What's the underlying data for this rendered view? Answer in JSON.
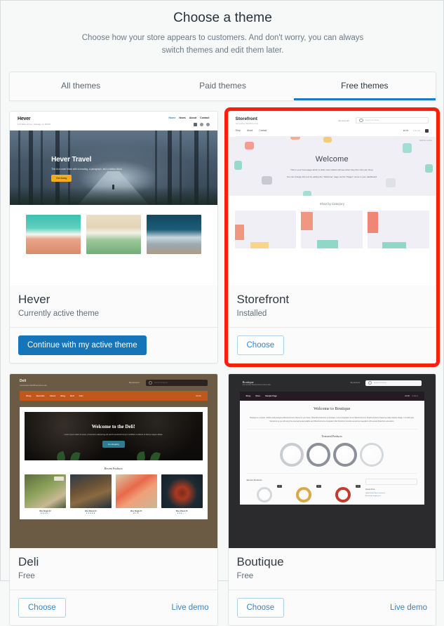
{
  "header": {
    "title": "Choose a theme",
    "subtitle": "Choose how your store appears to customers. And don't worry, you can always switch themes and edit them later."
  },
  "tabs": [
    {
      "label": "All themes",
      "active": false
    },
    {
      "label": "Paid themes",
      "active": false
    },
    {
      "label": "Free themes",
      "active": true
    }
  ],
  "colors": {
    "accent_blue": "#1A7BC4",
    "primary_button": "#1675B8",
    "link_blue": "#3784C4",
    "highlight_red": "#F8200D",
    "page_bg": "#F7F8F8",
    "card_bg": "#FBFBFC"
  },
  "themes": [
    {
      "name": "Hever",
      "status": "Currently active theme",
      "selected": false,
      "primary_action": "Continue with my active theme",
      "secondary_action": null,
      "demo_link": null,
      "preview": {
        "brand": "Hever",
        "address": "123 Main Street, Chicago, IL 60007",
        "nav": [
          "Home",
          "News",
          "About",
          "Contact"
        ],
        "hero_title": "Hever Travel",
        "hero_text": "This is a cover block with a heading, a paragraph, and a button block.",
        "hero_button": "Get Away"
      }
    },
    {
      "name": "Storefront",
      "status": "Installed",
      "selected": true,
      "primary_action": null,
      "secondary_action": "Choose",
      "demo_link": null,
      "preview": {
        "brand": "Storefront",
        "tagline": "Just another WordPress site",
        "account": "My Account",
        "search_placeholder": "Search Products",
        "nav": [
          "Shop",
          "About",
          "Contact"
        ],
        "cart_total": "£0.00",
        "cart_label": "0 items",
        "edit_label": "Edit this section",
        "hero_title": "Welcome",
        "hero_line1": "This is your homepage which is what most visitors will see when they first visit your shop.",
        "hero_line2": "You can change this text by editing the \"Welcome\" page via the \"Pages\" menu in your dashboard.",
        "section_title": "Shop by Category"
      }
    },
    {
      "name": "Deli",
      "status": "Free",
      "selected": false,
      "primary_action": null,
      "secondary_action": "Choose",
      "demo_link": "Live demo",
      "preview": {
        "brand": "Deli",
        "tagline": "Just another WordPress Demo site",
        "account": "My Account",
        "search_placeholder": "Search Products",
        "nav": [
          "Shop",
          "Specials",
          "About",
          "Blog",
          "Deli",
          "Cart"
        ],
        "cart_label": "£0.00",
        "hero_title": "Welcome to the Deli!",
        "hero_text": "Lorem ipsum dolor sit amet, consectetur adipiscing elit sed do eiusmod tempor incididunt ut labore et dolore magna aliqua.",
        "hero_button": "Go shopping",
        "section_title": "Recent Products",
        "products": [
          {
            "title": "Woo Single #2",
            "rating": "★★★★☆"
          },
          {
            "title": "Woo Album #4",
            "rating": "★★★★★"
          },
          {
            "title": "Woo Single #1",
            "rating": "£3.00"
          },
          {
            "title": "Woo Album #3",
            "rating": "★★★☆☆"
          }
        ]
      }
    },
    {
      "name": "Boutique",
      "status": "Free",
      "selected": false,
      "primary_action": null,
      "secondary_action": "Choose",
      "demo_link": "Live demo",
      "preview": {
        "brand": "Boutique",
        "tagline": "Just another WooCommerce Demo Site",
        "account": "My Account",
        "search_placeholder": "Search Products",
        "nav": [
          "Shop",
          "Store",
          "Sample Page"
        ],
        "cart_label": "£0.00",
        "cart_items": "0 items",
        "hero_title": "Welcome to Boutique",
        "hero_text": "Boutique is a simple, mobile-ready designed WooCommerce theme for your store. Powerful small store or boutique, it is an integration of our WooCommerce Storefront theme featuring a fully website design. It is built upon Storefront so you will enjoy the tried and tested reliable and WooCommerce integration that Storefront provides as well as integration with several Storefront extensions.",
        "featured_title": "Featured Products",
        "recent_title": "Recent Products",
        "sidebar_title": "Recent Posts",
        "sidebar_search_placeholder": "Search...",
        "sidebar_items": [
          "Hello World! Woo Commerce",
          "A second sample post"
        ]
      }
    }
  ]
}
